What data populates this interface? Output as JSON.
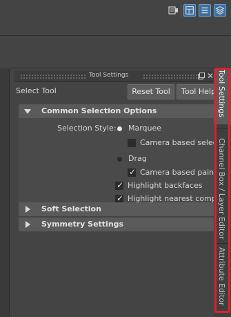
{
  "toolbar": {
    "icons": [
      "render-settings-icon",
      "workspace-layout-icon",
      "attribute-editor-toggle-icon",
      "channel-box-toggle-icon"
    ]
  },
  "panel": {
    "title": "Tool Settings",
    "tool_name": "Select Tool",
    "reset_button": "Reset Tool",
    "help_button": "Tool Help"
  },
  "sections": {
    "common": {
      "label": "Common Selection Options",
      "expanded": true
    },
    "soft": {
      "label": "Soft Selection",
      "expanded": false
    },
    "symmetry": {
      "label": "Symmetry Settings",
      "expanded": false
    }
  },
  "common_options": {
    "selection_style_label": "Selection Style:",
    "marquee_label": "Marquee",
    "marquee_selected": true,
    "camera_based_selection_label": "Camera based selection",
    "camera_based_selection_checked": false,
    "drag_label": "Drag",
    "drag_selected": false,
    "camera_based_paint_label": "Camera based paint selection",
    "camera_based_paint_checked": true,
    "highlight_backfaces_label": "Highlight backfaces",
    "highlight_backfaces_checked": true,
    "highlight_nearest_label": "Highlight nearest component",
    "highlight_nearest_checked": true
  },
  "side_tabs": {
    "tool_settings": "Tool Settings",
    "channel_box": "Channel Box / Layer Editor",
    "attribute_editor": "Attribute Editor"
  },
  "colors": {
    "background": "#444444",
    "section_header": "#5a5a5a",
    "active_icon": "#3b6f9e",
    "highlight_outline": "#e0212b"
  }
}
